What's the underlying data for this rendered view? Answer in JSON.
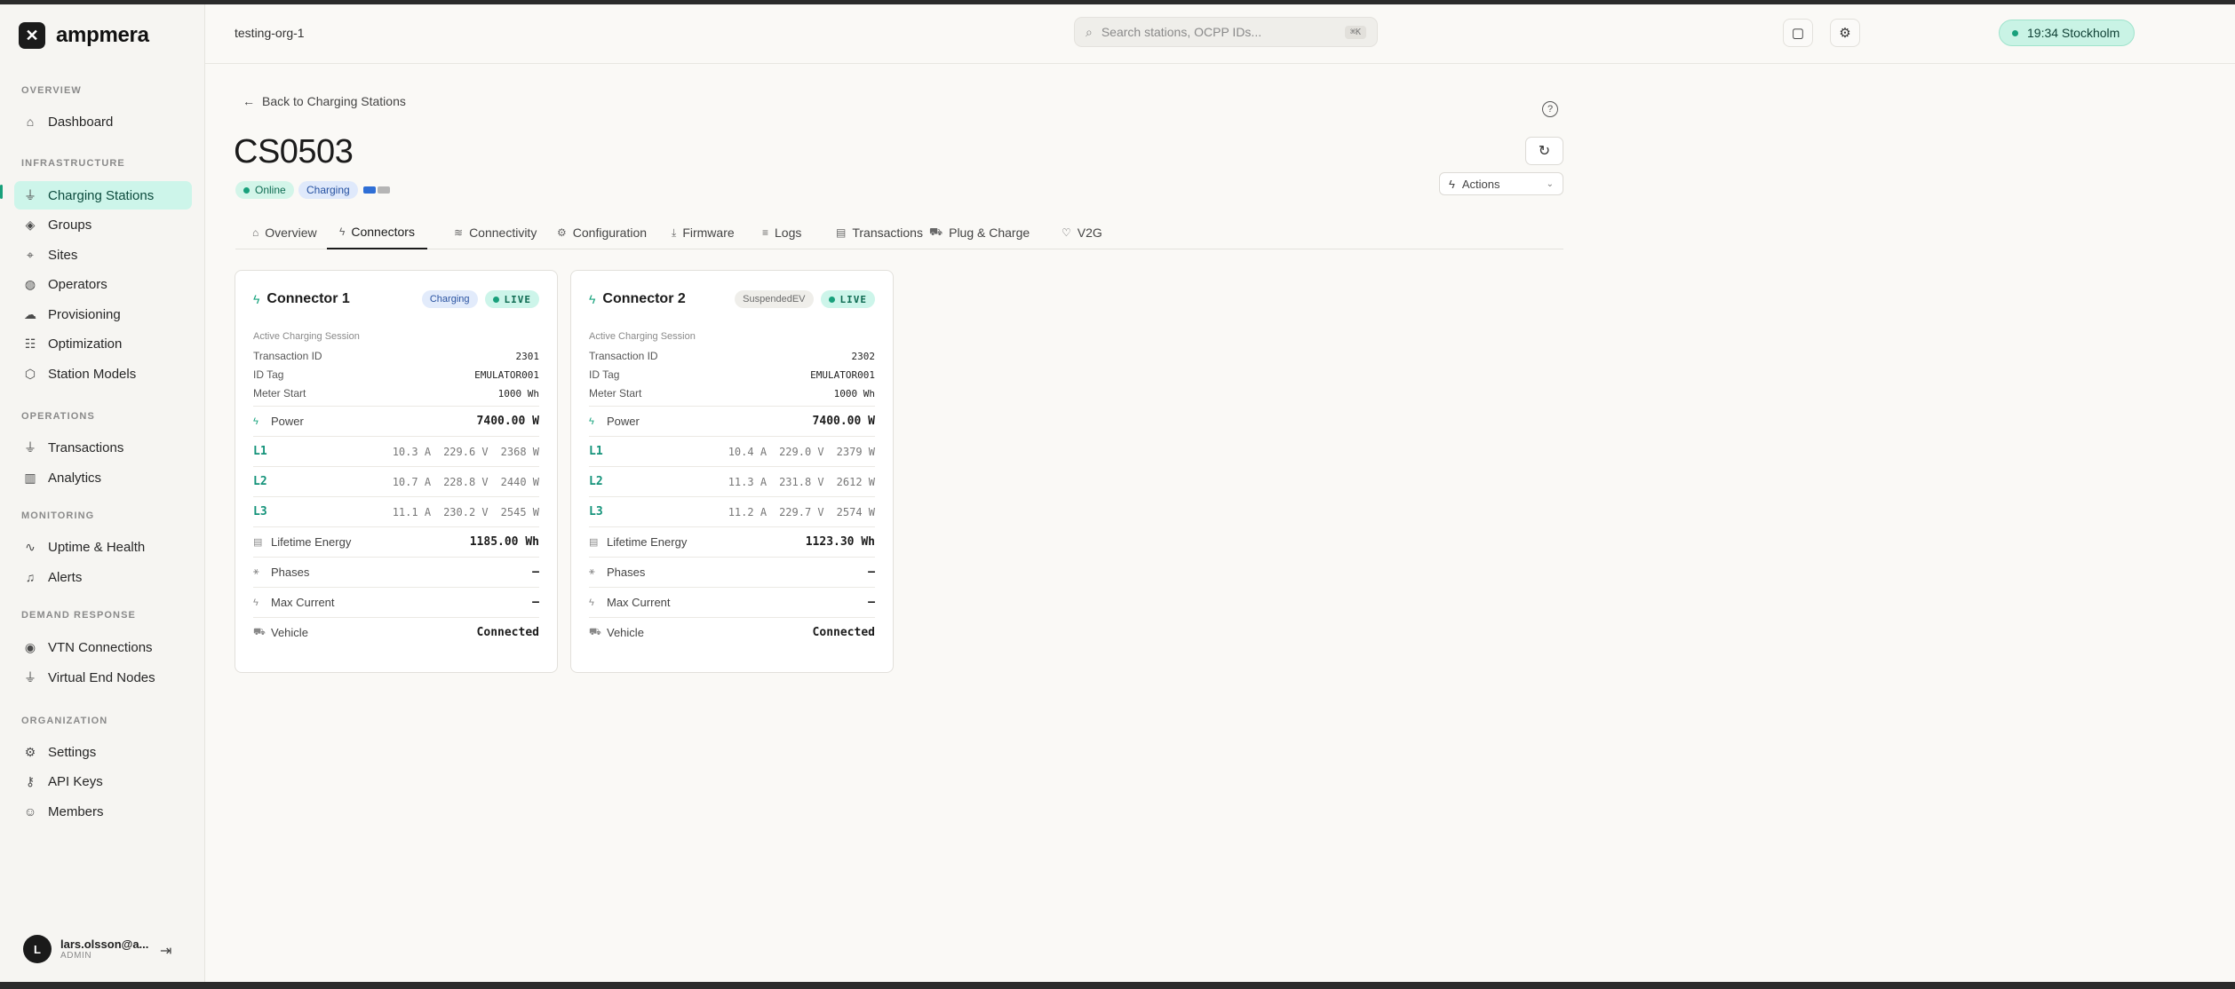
{
  "brand": {
    "name": "ampmera"
  },
  "sidebar": {
    "sections": [
      {
        "title": "OVERVIEW",
        "items": [
          {
            "label": "Dashboard",
            "icon": "home-icon"
          }
        ]
      },
      {
        "title": "INFRASTRUCTURE",
        "items": [
          {
            "label": "Charging Stations",
            "icon": "plug-icon",
            "active": true
          },
          {
            "label": "Groups",
            "icon": "layers-icon"
          },
          {
            "label": "Sites",
            "icon": "map-pin-icon"
          },
          {
            "label": "Operators",
            "icon": "globe-icon"
          },
          {
            "label": "Provisioning",
            "icon": "cloud-upload-icon"
          },
          {
            "label": "Optimization",
            "icon": "sliders-icon"
          },
          {
            "label": "Station Models",
            "icon": "box-icon"
          }
        ]
      },
      {
        "title": "OPERATIONS",
        "items": [
          {
            "label": "Transactions",
            "icon": "plug-icon"
          },
          {
            "label": "Analytics",
            "icon": "bar-chart-icon"
          }
        ]
      },
      {
        "title": "MONITORING",
        "items": [
          {
            "label": "Uptime & Health",
            "icon": "activity-icon"
          },
          {
            "label": "Alerts",
            "icon": "bell-icon"
          }
        ]
      },
      {
        "title": "DEMAND RESPONSE",
        "items": [
          {
            "label": "VTN Connections",
            "icon": "radio-icon"
          },
          {
            "label": "Virtual End Nodes",
            "icon": "plug-icon"
          }
        ]
      },
      {
        "title": "ORGANIZATION",
        "items": [
          {
            "label": "Settings",
            "icon": "gear-icon"
          },
          {
            "label": "API Keys",
            "icon": "key-icon"
          },
          {
            "label": "Members",
            "icon": "users-icon"
          }
        ]
      }
    ],
    "user": {
      "initial": "L",
      "name": "lars.olsson@a...",
      "role": "ADMIN"
    }
  },
  "header": {
    "org": "testing-org-1",
    "search_placeholder": "Search stations, OCPP IDs...",
    "search_shortcut": "⌘K",
    "clock": "19:34 Stockholm"
  },
  "page": {
    "back_label": "Back to Charging Stations",
    "title": "CS0503",
    "status_online": "Online",
    "status_charging": "Charging",
    "actions_label": "Actions",
    "connector_indicator_colors": [
      "#2f6fd6",
      "#b5b5b5"
    ],
    "tabs": [
      {
        "label": "Overview",
        "icon": "home-icon"
      },
      {
        "label": "Connectors",
        "icon": "bolt-icon",
        "active": true
      },
      {
        "label": "Connectivity",
        "icon": "wifi-icon"
      },
      {
        "label": "Configuration",
        "icon": "gear-icon"
      },
      {
        "label": "Firmware",
        "icon": "download-icon"
      },
      {
        "label": "Logs",
        "icon": "list-icon"
      },
      {
        "label": "Transactions",
        "icon": "receipt-icon"
      },
      {
        "label": "Plug & Charge",
        "icon": "car-icon"
      },
      {
        "label": "V2G",
        "icon": "shield-icon"
      }
    ]
  },
  "connectors": [
    {
      "title": "Connector 1",
      "status": "Charging",
      "live": "LIVE",
      "session_label": "Active Charging Session",
      "transaction_label": "Transaction ID",
      "transaction_id": "2301",
      "idtag_label": "ID Tag",
      "id_tag": "EMULATOR001",
      "meter_label": "Meter Start",
      "meter_start": "1000 Wh",
      "power_label": "Power",
      "power": "7400.00 W",
      "phases": [
        {
          "name": "L1",
          "current": "10.3 A",
          "voltage": "229.6 V",
          "power": "2368 W"
        },
        {
          "name": "L2",
          "current": "10.7 A",
          "voltage": "228.8 V",
          "power": "2440 W"
        },
        {
          "name": "L3",
          "current": "11.1 A",
          "voltage": "230.2 V",
          "power": "2545 W"
        }
      ],
      "lifetime_label": "Lifetime Energy",
      "lifetime": "1185.00 Wh",
      "phases_label": "Phases",
      "phases_value": "—",
      "maxcur_label": "Max Current",
      "maxcur_value": "—",
      "vehicle_label": "Vehicle",
      "vehicle_value": "Connected"
    },
    {
      "title": "Connector 2",
      "status": "SuspendedEV",
      "live": "LIVE",
      "session_label": "Active Charging Session",
      "transaction_label": "Transaction ID",
      "transaction_id": "2302",
      "idtag_label": "ID Tag",
      "id_tag": "EMULATOR001",
      "meter_label": "Meter Start",
      "meter_start": "1000 Wh",
      "power_label": "Power",
      "power": "7400.00 W",
      "phases": [
        {
          "name": "L1",
          "current": "10.4 A",
          "voltage": "229.0 V",
          "power": "2379 W"
        },
        {
          "name": "L2",
          "current": "11.3 A",
          "voltage": "231.8 V",
          "power": "2612 W"
        },
        {
          "name": "L3",
          "current": "11.2 A",
          "voltage": "229.7 V",
          "power": "2574 W"
        }
      ],
      "lifetime_label": "Lifetime Energy",
      "lifetime": "1123.30 Wh",
      "phases_label": "Phases",
      "phases_value": "—",
      "maxcur_label": "Max Current",
      "maxcur_value": "—",
      "vehicle_label": "Vehicle",
      "vehicle_value": "Connected"
    }
  ]
}
